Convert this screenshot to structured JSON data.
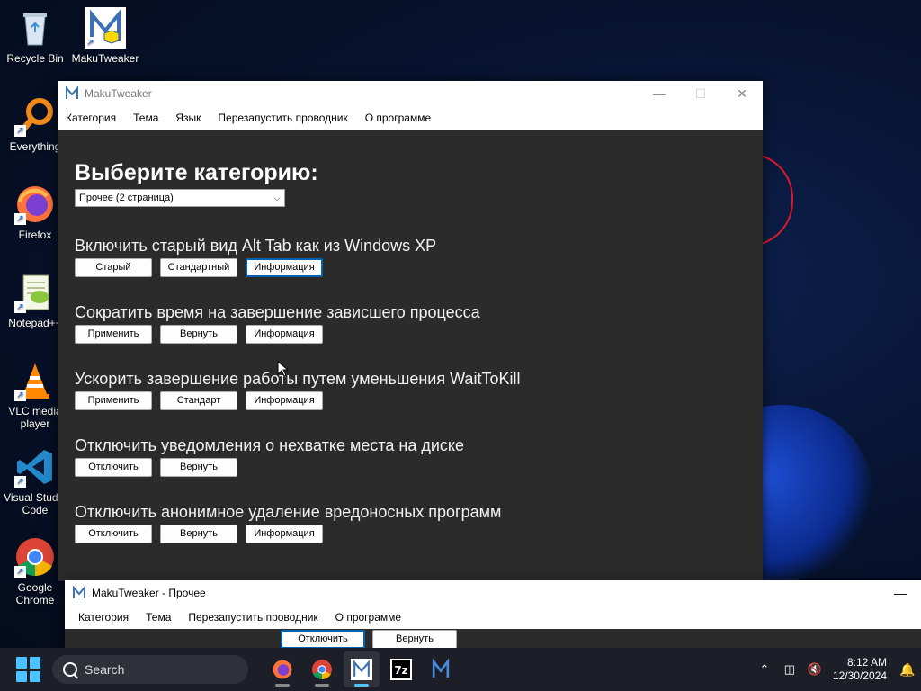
{
  "desktop": {
    "icons": [
      {
        "label": "Recycle Bin"
      },
      {
        "label": "MakuTweaker"
      },
      {
        "label": "Everything"
      },
      {
        "label": "Firefox"
      },
      {
        "label": "Notepad++"
      },
      {
        "label": "VLC media player"
      },
      {
        "label": "Visual Studio Code"
      },
      {
        "label": "Google Chrome"
      }
    ]
  },
  "window": {
    "title": "MakuTweaker",
    "controls": {
      "minimize": "—",
      "maximize": "☐",
      "close": "✕"
    },
    "menu": [
      "Категория",
      "Тема",
      "Язык",
      "Перезапустить проводник",
      "О программе"
    ],
    "heading": "Выберите категорию:",
    "category_select": {
      "value": "Прочее (2 страница)"
    },
    "sections": [
      {
        "title": "Включить старый вид Alt Tab как из Windows XP",
        "buttons": [
          "Старый",
          "Стандартный",
          "Информация"
        ]
      },
      {
        "title": "Сократить время на завершение зависшего процесса",
        "buttons": [
          "Применить",
          "Вернуть",
          "Информация"
        ]
      },
      {
        "title": "Ускорить завершение работы путем уменьшения WaitToKill",
        "buttons": [
          "Применить",
          "Стандарт",
          "Информация"
        ]
      },
      {
        "title": "Отключить уведомления о нехватке места на диске",
        "buttons": [
          "Отключить",
          "Вернуть"
        ]
      },
      {
        "title": "Отключить анонимное удаление вредоносных программ",
        "buttons": [
          "Отключить",
          "Вернуть",
          "Информация"
        ]
      }
    ]
  },
  "window2": {
    "title": "MakuTweaker - Прочее",
    "minimize": "—",
    "menu": [
      "Категория",
      "Тема",
      "Перезапустить проводник",
      "О программе"
    ],
    "buttons": [
      "Отключить",
      "Вернуть"
    ]
  },
  "taskbar": {
    "search_placeholder": "Search",
    "apps": [
      "firefox",
      "chrome",
      "makutweaker",
      "7zip",
      "makutweaker-2"
    ],
    "time": "8:12 AM",
    "date": "12/30/2024"
  },
  "colors": {
    "window_bg": "#2b2b2b",
    "accent": "#0063b1",
    "taskbar_bg": "#1c1f27"
  }
}
